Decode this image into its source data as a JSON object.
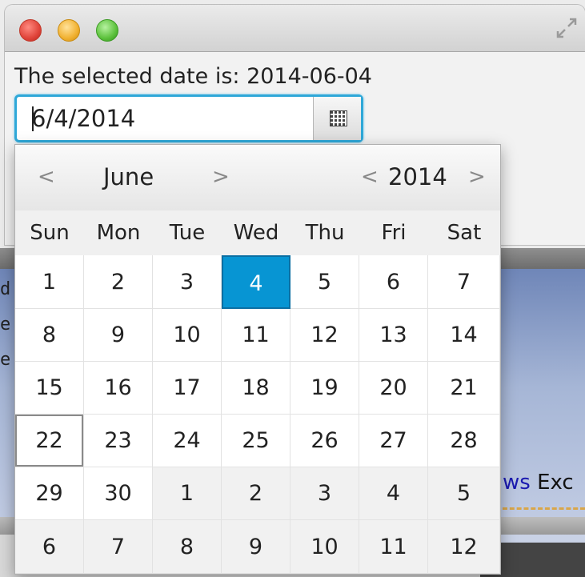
{
  "window": {
    "label": "The selected date is: 2014-06-04",
    "date_field_value": "6/4/2014"
  },
  "calendar": {
    "month": "June",
    "year": "2014",
    "prev": "<",
    "next": ">",
    "weekdays": [
      "Sun",
      "Mon",
      "Tue",
      "Wed",
      "Thu",
      "Fri",
      "Sat"
    ],
    "weeks": [
      [
        "1",
        "2",
        "3",
        "4",
        "5",
        "6",
        "7"
      ],
      [
        "8",
        "9",
        "10",
        "11",
        "12",
        "13",
        "14"
      ],
      [
        "15",
        "16",
        "17",
        "18",
        "19",
        "20",
        "21"
      ],
      [
        "22",
        "23",
        "24",
        "25",
        "26",
        "27",
        "28"
      ],
      [
        "29",
        "30",
        "1",
        "2",
        "3",
        "4",
        "5"
      ],
      [
        "6",
        "7",
        "8",
        "9",
        "10",
        "11",
        "12"
      ]
    ],
    "selected_day": "4",
    "today_day": "22",
    "selected_color": "#0795d3"
  },
  "background": {
    "code_keyword": "ws",
    "code_text": " Exc",
    "edge_letters": [
      "d",
      "e",
      "e"
    ]
  },
  "icons": {
    "window_controls": [
      "close-icon",
      "minimize-icon",
      "zoom-icon"
    ],
    "fullscreen": "fullscreen-icon",
    "calendar_button": "calendar-grid-icon"
  }
}
